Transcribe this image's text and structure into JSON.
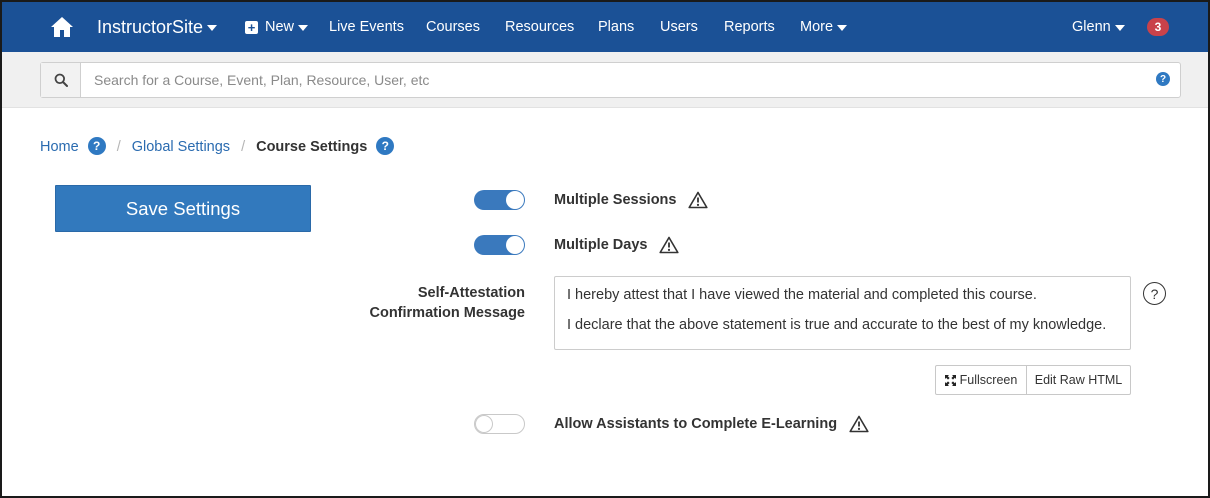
{
  "navbar": {
    "home_icon": "home-icon",
    "brand": "InstructorSite",
    "new_label": "New",
    "links": [
      "Live Events",
      "Courses",
      "Resources",
      "Plans",
      "Users",
      "Reports"
    ],
    "more_label": "More",
    "user_name": "Glenn",
    "notification_count": "3",
    "colors": {
      "bar": "#1b5196",
      "badge": "#c9424a"
    }
  },
  "search": {
    "placeholder": "Search for a Course, Event, Plan, Resource, User, etc",
    "value": "",
    "icon": "search-icon",
    "help_icon": "help-circle-icon"
  },
  "breadcrumb": {
    "home": "Home",
    "global_settings": "Global Settings",
    "current": "Course Settings",
    "separator": "/"
  },
  "actions": {
    "save_label": "Save Settings",
    "accent": "#3279bd"
  },
  "settings": {
    "multiple_sessions": {
      "label": "Multiple Sessions",
      "enabled": true
    },
    "multiple_days": {
      "label": "Multiple Days",
      "enabled": true
    },
    "self_attestation": {
      "label_line1": "Self-Attestation",
      "label_line2": "Confirmation Message",
      "paragraphs": [
        "I hereby attest that I have viewed the material and completed this course.",
        "I declare that the above statement is true and accurate to the best of my knowledge."
      ],
      "help": "?"
    },
    "editor_buttons": {
      "fullscreen": "Fullscreen",
      "edit_raw_html": "Edit Raw HTML"
    },
    "allow_assistants": {
      "label": "Allow Assistants to Complete E-Learning",
      "enabled": false
    }
  }
}
